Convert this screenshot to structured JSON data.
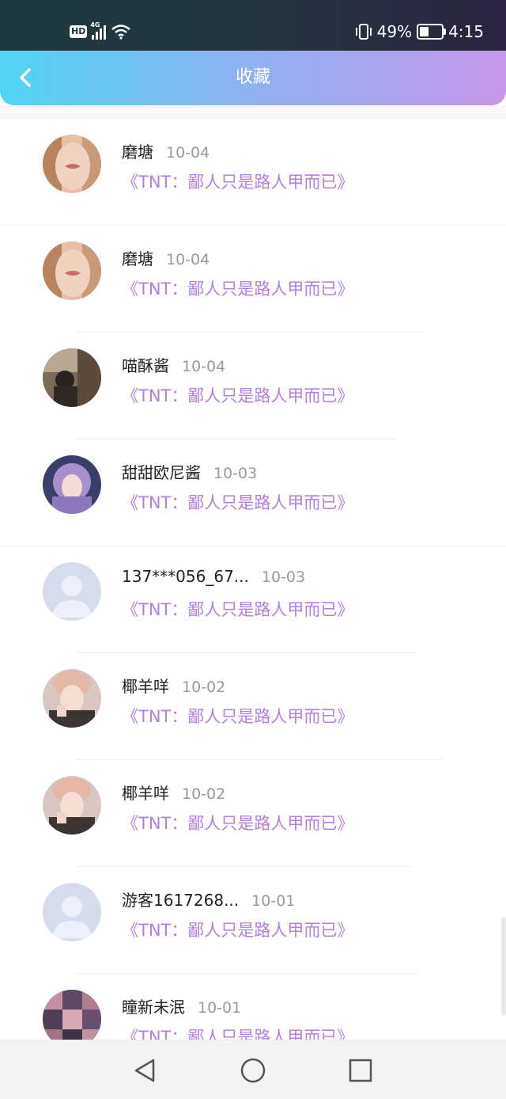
{
  "status_bar": {
    "hd": "HD",
    "network": "4G",
    "battery_percent": "49%",
    "battery_level": 0.49,
    "time": "4:15"
  },
  "header": {
    "title": "收藏"
  },
  "items": [
    {
      "name": "磨塘",
      "date": "10-04",
      "work": "《TNT：鄙人只是路人甲而已》",
      "avatar": "photo-girl-lips"
    },
    {
      "name": "磨塘",
      "date": "10-04",
      "work": "《TNT：鄙人只是路人甲而已》",
      "avatar": "photo-girl-lips"
    },
    {
      "name": "喵酥酱",
      "date": "10-04",
      "work": "《TNT：鄙人只是路人甲而已》",
      "avatar": "photo-girl-window"
    },
    {
      "name": "甜甜欧尼酱",
      "date": "10-03",
      "work": "《TNT：鄙人只是路人甲而已》",
      "avatar": "photo-purple-hair"
    },
    {
      "name": "137***056_67...",
      "date": "10-03",
      "work": "《TNT：鄙人只是路人甲而已》",
      "avatar": "default-user-icon"
    },
    {
      "name": "椰羊咩",
      "date": "10-02",
      "work": "《TNT：鄙人只是路人甲而已》",
      "avatar": "photo-boy"
    },
    {
      "name": "椰羊咩",
      "date": "10-02",
      "work": "《TNT：鄙人只是路人甲而已》",
      "avatar": "photo-boy"
    },
    {
      "name": "游客1617268...",
      "date": "10-01",
      "work": "《TNT：鄙人只是路人甲而已》",
      "avatar": "default-user-icon"
    },
    {
      "name": "瞳新未泯",
      "date": "10-01",
      "work": "《TNT：鄙人只是路人甲而已》",
      "avatar": "photo-collage"
    }
  ],
  "colors": {
    "header_start": "#50d5f2",
    "header_end": "#c596ea",
    "work_title": "#b37fe0",
    "date": "#999999"
  },
  "nav": {
    "back_icon": "back-triangle-icon",
    "home_icon": "home-circle-icon",
    "recents_icon": "recents-square-icon"
  }
}
